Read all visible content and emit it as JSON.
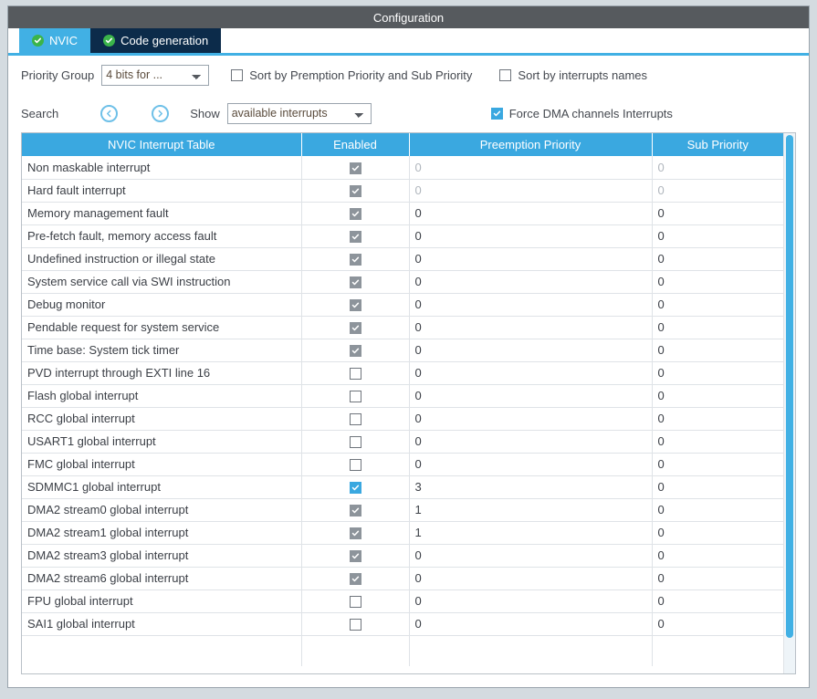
{
  "window": {
    "title": "Configuration"
  },
  "tabs": [
    {
      "label": "NVIC",
      "icon": "check-circle-icon",
      "active": true
    },
    {
      "label": "Code generation",
      "icon": "check-circle-icon",
      "active": false
    }
  ],
  "toolbar": {
    "priority_group_label": "Priority Group",
    "priority_group_value": "4 bits for ...",
    "sort_by_preemption_label": "Sort by Premption Priority and Sub Priority",
    "sort_by_preemption_checked": false,
    "sort_by_names_label": "Sort by interrupts names",
    "sort_by_names_checked": false,
    "search_label": "Search",
    "search_prev_icon": "chevron-left-circle-icon",
    "search_next_icon": "chevron-right-circle-icon",
    "show_label": "Show",
    "show_value": "available interrupts",
    "force_dma_label": "Force DMA channels Interrupts",
    "force_dma_checked": true
  },
  "table": {
    "columns": [
      "NVIC Interrupt Table",
      "Enabled",
      "Preemption Priority",
      "Sub Priority"
    ],
    "rows": [
      {
        "name": "Non maskable interrupt",
        "enabled": "checked-grey",
        "preemption": "0",
        "sub": "0",
        "dim": true
      },
      {
        "name": "Hard fault interrupt",
        "enabled": "checked-grey",
        "preemption": "0",
        "sub": "0",
        "dim": true
      },
      {
        "name": "Memory management fault",
        "enabled": "checked-grey",
        "preemption": "0",
        "sub": "0",
        "dim": false
      },
      {
        "name": "Pre-fetch fault, memory access fault",
        "enabled": "checked-grey",
        "preemption": "0",
        "sub": "0",
        "dim": false
      },
      {
        "name": "Undefined instruction or illegal state",
        "enabled": "checked-grey",
        "preemption": "0",
        "sub": "0",
        "dim": false
      },
      {
        "name": "System service call via SWI instruction",
        "enabled": "checked-grey",
        "preemption": "0",
        "sub": "0",
        "dim": false
      },
      {
        "name": "Debug monitor",
        "enabled": "checked-grey",
        "preemption": "0",
        "sub": "0",
        "dim": false
      },
      {
        "name": "Pendable request for system service",
        "enabled": "checked-grey",
        "preemption": "0",
        "sub": "0",
        "dim": false
      },
      {
        "name": "Time base: System tick timer",
        "enabled": "checked-grey",
        "preemption": "0",
        "sub": "0",
        "dim": false
      },
      {
        "name": "PVD interrupt through EXTI line 16",
        "enabled": "unchecked",
        "preemption": "0",
        "sub": "0",
        "dim": false
      },
      {
        "name": "Flash global interrupt",
        "enabled": "unchecked",
        "preemption": "0",
        "sub": "0",
        "dim": false
      },
      {
        "name": "RCC global interrupt",
        "enabled": "unchecked",
        "preemption": "0",
        "sub": "0",
        "dim": false
      },
      {
        "name": "USART1 global interrupt",
        "enabled": "unchecked",
        "preemption": "0",
        "sub": "0",
        "dim": false
      },
      {
        "name": "FMC global interrupt",
        "enabled": "unchecked",
        "preemption": "0",
        "sub": "0",
        "dim": false
      },
      {
        "name": "SDMMC1 global interrupt",
        "enabled": "checked-blue",
        "preemption": "3",
        "sub": "0",
        "dim": false
      },
      {
        "name": "DMA2 stream0 global interrupt",
        "enabled": "checked-grey",
        "preemption": "1",
        "sub": "0",
        "dim": false
      },
      {
        "name": "DMA2 stream1 global interrupt",
        "enabled": "checked-grey",
        "preemption": "1",
        "sub": "0",
        "dim": false
      },
      {
        "name": "DMA2 stream3 global interrupt",
        "enabled": "checked-grey",
        "preemption": "0",
        "sub": "0",
        "dim": false
      },
      {
        "name": "DMA2 stream6 global interrupt",
        "enabled": "checked-grey",
        "preemption": "0",
        "sub": "0",
        "dim": false
      },
      {
        "name": "FPU global interrupt",
        "enabled": "unchecked",
        "preemption": "0",
        "sub": "0",
        "dim": false
      },
      {
        "name": "SAI1 global interrupt",
        "enabled": "unchecked",
        "preemption": "0",
        "sub": "0",
        "dim": false
      }
    ]
  },
  "colors": {
    "accent": "#41b0e4",
    "header": "#3aa8e0",
    "tab_inactive": "#0c2b4a",
    "titlebar": "#565a5e",
    "ok_green": "#3bb44a",
    "disabled_check": "#8d949b",
    "page_background": "#d4dbe0"
  }
}
